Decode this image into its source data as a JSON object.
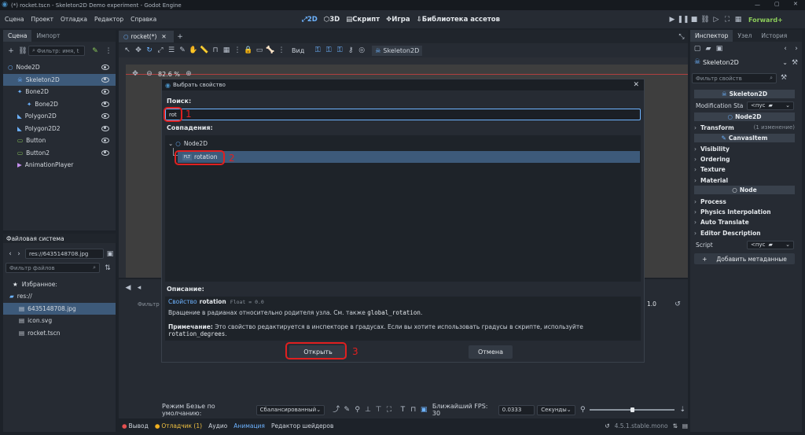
{
  "window": {
    "title": "(*) rocket.tscn - Skeleton2D Demo experiment - Godot Engine"
  },
  "menu": {
    "items": [
      "Сцена",
      "Проект",
      "Отладка",
      "Редактор",
      "Справка"
    ]
  },
  "modes": {
    "m2d": "2D",
    "m3d": "3D",
    "script": "Скрипт",
    "game": "Игра",
    "assets": "Библиотека ассетов"
  },
  "renderer": "Forward+",
  "scene_panel": {
    "tabs": [
      "Сцена",
      "Импорт"
    ],
    "filter_placeholder": "Фильтр: имя, t",
    "nodes": [
      {
        "label": "Node2D",
        "icon": "node2d-icon",
        "depth": 0
      },
      {
        "label": "Skeleton2D",
        "icon": "skeleton2d-icon",
        "depth": 1,
        "selected": true
      },
      {
        "label": "Bone2D",
        "icon": "bone2d-icon",
        "depth": 1
      },
      {
        "label": "Bone2D",
        "icon": "bone2d-icon",
        "depth": 2
      },
      {
        "label": "Polygon2D",
        "icon": "polygon2d-icon",
        "depth": 1
      },
      {
        "label": "Polygon2D2",
        "icon": "polygon2d-icon",
        "depth": 1
      },
      {
        "label": "Button",
        "icon": "button-icon",
        "depth": 1
      },
      {
        "label": "Button2",
        "icon": "button-icon",
        "depth": 1
      },
      {
        "label": "AnimationPlayer",
        "icon": "animation-player-icon",
        "depth": 1
      }
    ]
  },
  "fs_panel": {
    "title": "Файловая система",
    "path": "res://6435148708.jpg",
    "filter_placeholder": "Фильтр файлов",
    "favorites": "Избранное:",
    "items": [
      {
        "label": "res://",
        "depth": 0
      },
      {
        "label": "6435148708.jpg",
        "depth": 1,
        "selected": true
      },
      {
        "label": "icon.svg",
        "depth": 1
      },
      {
        "label": "rocket.tscn",
        "depth": 1
      }
    ]
  },
  "editor": {
    "tab": "rocket(*)",
    "view_label": "Вид",
    "toolbar_node": "Skeleton2D",
    "zoom": "82.6 %"
  },
  "anim": {
    "filter": "Фильтр",
    "value": "1.0"
  },
  "bottom": {
    "bezier_label": "Режим Безье по умолчанию:",
    "bezier_value": "Сбалансированный",
    "fps_label": "Ближайший FPS: 30",
    "step_value": "0.0333",
    "unit_value": "Секунды",
    "tabs": [
      "Вывод",
      "Отладчик (1)",
      "Аудио",
      "Анимация",
      "Редактор шейдеров"
    ],
    "version": "4.5.1.stable.mono"
  },
  "inspector": {
    "tabs": [
      "Инспектор",
      "Узел",
      "История"
    ],
    "node": "Skeleton2D",
    "filter_placeholder": "Фильтр свойств",
    "class_header": "Skeleton2D",
    "modification_label": "Modification Sta",
    "modification_value": "<пус",
    "node2d_header": "Node2D",
    "transform_label": "Transform",
    "transform_changes": "(1 изменение)",
    "canvasitem_header": "CanvasItem",
    "canvasitem_sections": [
      "Visibility",
      "Ordering",
      "Texture",
      "Material"
    ],
    "node_header": "Node",
    "node_sections": [
      "Process",
      "Physics Interpolation",
      "Auto Translate",
      "Editor Description"
    ],
    "script_label": "Script",
    "script_value": "<пус",
    "add_metadata": "Добавить метаданные"
  },
  "dialog": {
    "title": "Выбрать свойство",
    "search_label": "Поиск:",
    "search_value": "rot",
    "matches_label": "Совпадения:",
    "tree_root": "Node2D",
    "match_item": "rotation",
    "match_badge": "FLT",
    "description_label": "Описание:",
    "prop_prefix": "Свойство",
    "prop_name": "rotation",
    "prop_type": "Float = 0.0",
    "desc_text": "Вращение в радианах относительно родителя узла. См. также",
    "desc_ref": "global_rotation",
    "desc_end": ".",
    "note_bold": "Примечание:",
    "note_text": "Это свойство редактируется в инспекторе в градусах. Если вы хотите использовать градусы в скрипте, используйте",
    "note_ref": "rotation_degrees",
    "note_end": ".",
    "open_button": "Открыть",
    "cancel_button": "Отмена"
  },
  "annotations": [
    "1",
    "2",
    "3"
  ],
  "colors": {
    "accent": "#6db3ff",
    "highlight": "#e02020",
    "selected": "#3d5a7a"
  }
}
